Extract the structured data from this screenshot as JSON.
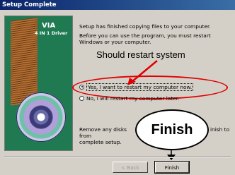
{
  "window": {
    "title": "Setup Complete"
  },
  "sidebar": {
    "brand": "VIA",
    "product": "4 IN 1 Driver"
  },
  "content": {
    "paragraph1": "Setup has finished copying files to your computer.",
    "paragraph2": "Before you can use the program, you must restart Windows or your computer.",
    "options": [
      {
        "label": "Yes, I want to restart my computer now.",
        "selected": true
      },
      {
        "label": "No, I will restart my computer later.",
        "selected": false
      }
    ],
    "paragraph3_left": "Remove any disks from",
    "paragraph3_right": "inish to",
    "paragraph3_line2": "complete setup."
  },
  "annotations": {
    "restart_callout": "Should restart system",
    "finish_callout": "Finish",
    "highlight_color": "#e00000"
  },
  "buttons": {
    "back": "< Back",
    "finish": "Finish"
  }
}
